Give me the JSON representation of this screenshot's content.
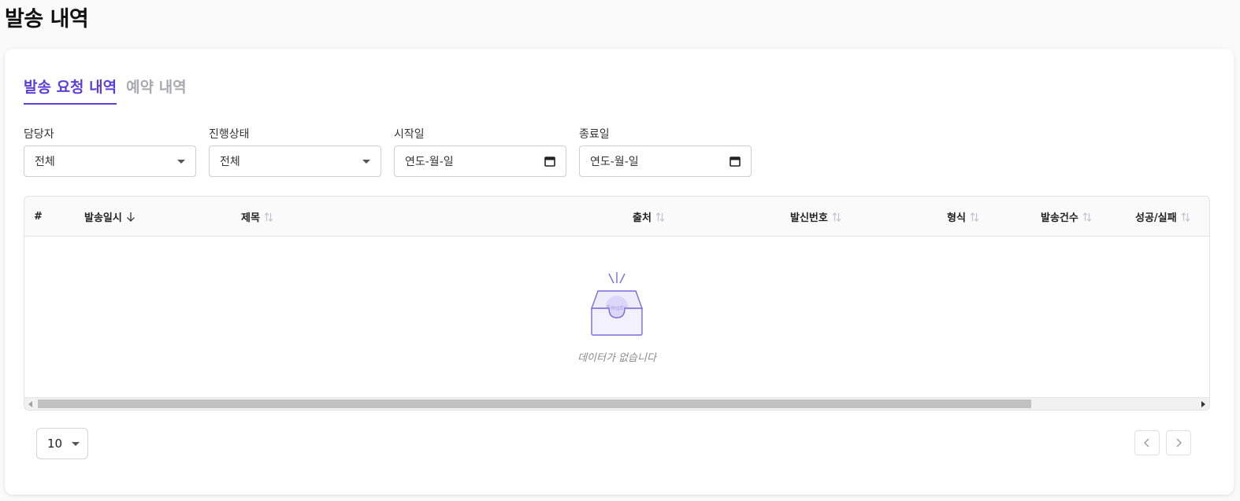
{
  "page": {
    "title": "발송 내역"
  },
  "tabs": [
    {
      "label": "발송 요청 내역",
      "active": true
    },
    {
      "label": "예약 내역",
      "active": false
    }
  ],
  "filters": {
    "manager": {
      "label": "담당자",
      "value": "전체"
    },
    "status": {
      "label": "진행상태",
      "value": "전체"
    },
    "start_date": {
      "label": "시작일",
      "placeholder": "연도-월-일"
    },
    "end_date": {
      "label": "종료일",
      "placeholder": "연도-월-일"
    }
  },
  "table": {
    "columns": [
      {
        "label": "#",
        "sort": "none"
      },
      {
        "label": "발송일시",
        "sort": "desc"
      },
      {
        "label": "제목",
        "sort": "sortable"
      },
      {
        "label": "출처",
        "sort": "sortable"
      },
      {
        "label": "발신번호",
        "sort": "sortable"
      },
      {
        "label": "형식",
        "sort": "sortable"
      },
      {
        "label": "발송건수",
        "sort": "sortable"
      },
      {
        "label": "성공/실패",
        "sort": "sortable"
      }
    ],
    "rows": [],
    "empty": {
      "illustration_text": "Empty",
      "message": "데이터가 없습니다"
    }
  },
  "pagination": {
    "page_size": "10"
  },
  "colors": {
    "accent": "#5b3fd8",
    "muted_tab": "#a9a9b1",
    "empty_illustration": "#7a6be0"
  }
}
